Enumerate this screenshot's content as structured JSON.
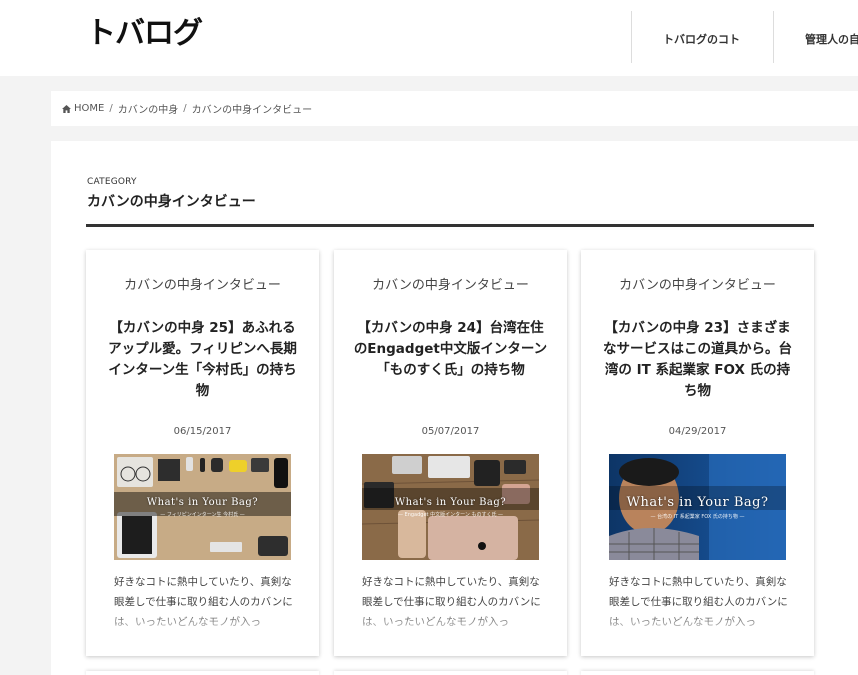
{
  "header": {
    "logo": "トバログ",
    "nav": [
      "トバログのコト",
      "管理人の自"
    ]
  },
  "breadcrumb": {
    "home": "HOME",
    "items": [
      "カバンの中身",
      "カバンの中身インタビュー"
    ],
    "separator": "/"
  },
  "category": {
    "label": "CATEGORY",
    "title": "カバンの中身インタビュー"
  },
  "cards": [
    {
      "category": "カバンの中身インタビュー",
      "title": "【カバンの中身 25】あふれるアップル愛。フィリピンへ長期インターン生「今村氏」の持ち物",
      "date": "06/15/2017",
      "thumb_title": "What's in Your Bag?",
      "thumb_sub": "— フィリピンインターン生 今村氏 —",
      "excerpt": "好きなコトに熱中していたり、真剣な眼差しで仕事に取り組む人のカバンには、いったいどんなモノが入っ"
    },
    {
      "category": "カバンの中身インタビュー",
      "title": "【カバンの中身 24】台湾在住のEngadget中文版インターン「ものすく氏」の持ち物",
      "date": "05/07/2017",
      "thumb_title": "What's in Your Bag?",
      "thumb_sub": "— Engadget 中文版インターン ものすく氏 —",
      "excerpt": "好きなコトに熱中していたり、真剣な眼差しで仕事に取り組む人のカバンには、いったいどんなモノが入っ"
    },
    {
      "category": "カバンの中身インタビュー",
      "title": "【カバンの中身 23】さまざまなサービスはこの道具から。台湾の IT 系起業家 FOX 氏の持ち物",
      "date": "04/29/2017",
      "thumb_title": "What's in Your Bag?",
      "thumb_sub": "— 台湾の IT 系起業家 FOX 氏の持ち物 —",
      "excerpt": "好きなコトに熱中していたり、真剣な眼差しで仕事に取り組む人のカバンには、いったいどんなモノが入っ"
    }
  ],
  "colors": {
    "background": "#f3f3f3",
    "panel": "#ffffff",
    "text": "#333333",
    "rule": "#333333"
  }
}
